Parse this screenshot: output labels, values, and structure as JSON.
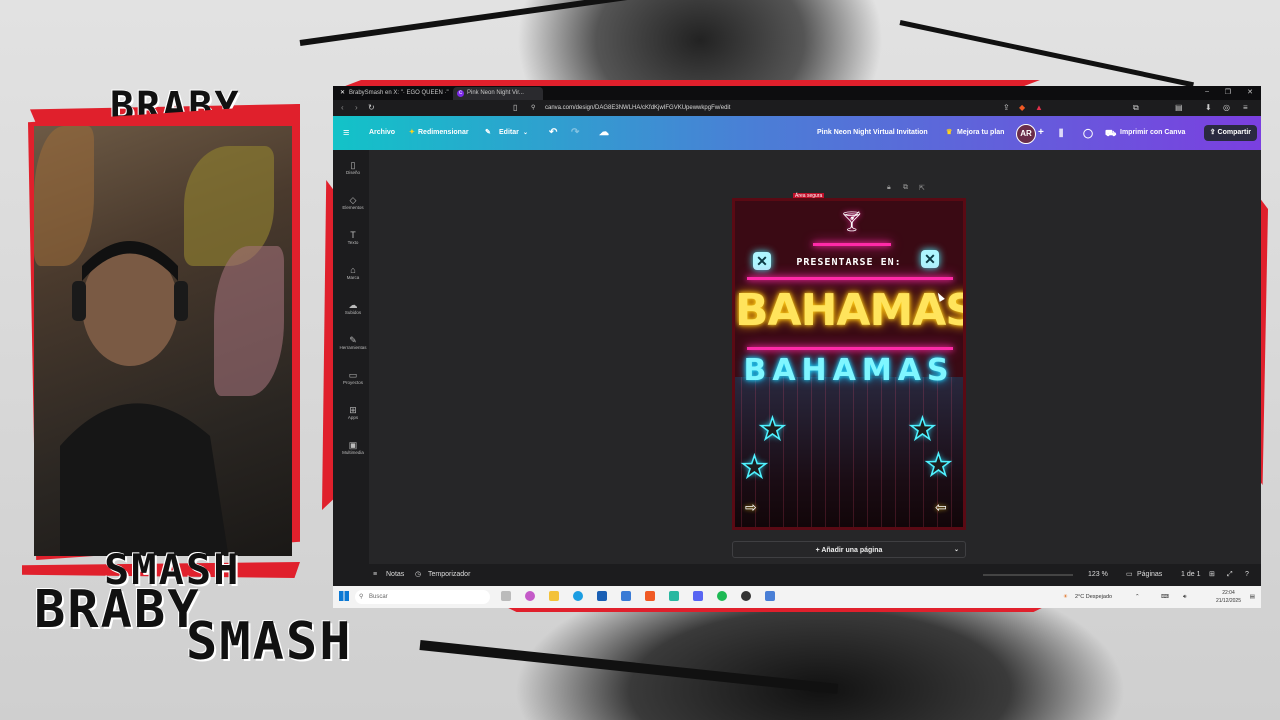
{
  "overlay": {
    "top_title": "BRABY",
    "bottom_title_1": "SMASH",
    "bottom_title_2": "BRABY",
    "bottom_title_3": "SMASH"
  },
  "browser": {
    "tabs": [
      {
        "label": "BrabySmash en X: \"· EGO QUEEN ·\"",
        "icon": "x-logo-icon"
      },
      {
        "label": "Pink Neon Night Vir...",
        "icon": "canva-icon"
      }
    ],
    "url": "canva.com/design/DAG8E3NWLHA/cKfdKjwIFGVKUpewwkpgFw/edit"
  },
  "canva": {
    "menu": {
      "file": "Archivo",
      "resize": "Redimensionar",
      "edit": "Editar",
      "design_title": "Pink Neon Night Virtual Invitation",
      "upgrade": "Mejora tu plan",
      "avatar": "AR",
      "print": "Imprimir con Canva",
      "share": "Compartir"
    },
    "sidebar": [
      {
        "label": "Diseño",
        "icon": "layout-icon"
      },
      {
        "label": "Elementos",
        "icon": "elements-icon"
      },
      {
        "label": "Texto",
        "icon": "text-icon"
      },
      {
        "label": "Marca",
        "icon": "brand-icon"
      },
      {
        "label": "Subidos",
        "icon": "upload-icon"
      },
      {
        "label": "Herramientas",
        "icon": "draw-icon"
      },
      {
        "label": "Proyectos",
        "icon": "folder-icon"
      },
      {
        "label": "Apps",
        "icon": "apps-icon"
      },
      {
        "label": "Multimedia",
        "icon": "media-icon"
      }
    ],
    "safe_area_label": "Área segura",
    "design": {
      "present_label": "PRESENTARSE EN:",
      "headline": "BAHAMAS",
      "subheadline": "BAHAMAS",
      "colors": {
        "pink": "#ff2aa8",
        "gold": "#ffe45c",
        "cyan": "#7ff6ff"
      }
    },
    "add_page": "+ Añadir una página",
    "bottom": {
      "notes": "Notas",
      "timer": "Temporizador",
      "zoom": "123 %",
      "pages_label": "Páginas",
      "page_count": "1 de 1"
    }
  },
  "taskbar": {
    "search_placeholder": "Buscar",
    "weather": "2°C  Despejado",
    "time": "22:04",
    "date": "21/12/2025"
  }
}
